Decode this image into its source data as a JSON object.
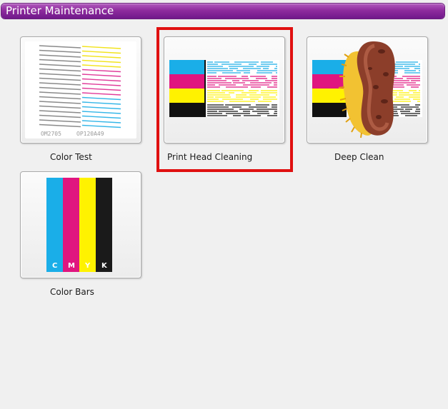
{
  "window": {
    "title": "Printer Maintenance"
  },
  "tiles": [
    {
      "label": "Color Test",
      "codes": [
        "OM2705",
        "OP120A49"
      ]
    },
    {
      "label": "Print Head Cleaning",
      "selected": true
    },
    {
      "label": "Deep Clean"
    },
    {
      "label": "Color Bars",
      "bar_letters": [
        "C",
        "M",
        "Y",
        "K"
      ]
    }
  ],
  "colors": {
    "title_bar": "#8e2c9e",
    "selection": "#e01010",
    "cyan": "#1aaee8",
    "magenta": "#e0157f",
    "yellow": "#fff200",
    "black": "#111111"
  },
  "icons": [
    "test-pattern-icon",
    "print-head-cleaning-icon",
    "sponge-cleaning-icon",
    "cmyk-bars-icon"
  ]
}
